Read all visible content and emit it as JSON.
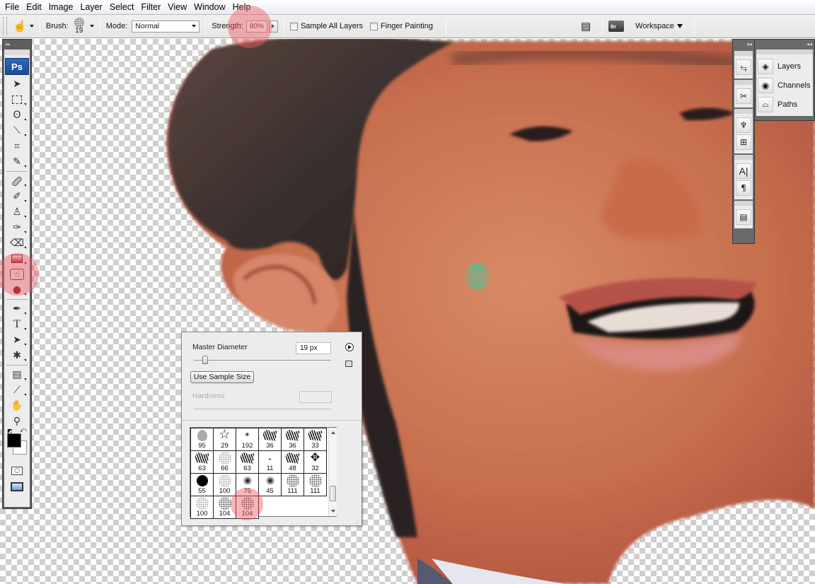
{
  "menu": [
    "File",
    "Edit",
    "Image",
    "Layer",
    "Select",
    "Filter",
    "View",
    "Window",
    "Help"
  ],
  "options_bar": {
    "tool_preset_icon": "smudge-tool-icon",
    "brush_label": "Brush:",
    "brush_size": "19",
    "mode_label": "Mode:",
    "mode_value": "Normal",
    "strength_label": "Strength:",
    "strength_value": "80%",
    "sample_all_layers_label": "Sample All Layers",
    "sample_all_layers_checked": false,
    "finger_painting_label": "Finger Painting",
    "finger_painting_checked": false,
    "workspace_label": "Workspace"
  },
  "toolbox": {
    "logo": "Ps",
    "tools": [
      {
        "name": "move-tool",
        "glyph": "➤"
      },
      {
        "name": "marquee-tool",
        "glyph": "⬚"
      },
      {
        "name": "lasso-tool",
        "glyph": "ʘ"
      },
      {
        "name": "quick-selection-tool",
        "glyph": "⟋"
      },
      {
        "name": "crop-tool",
        "glyph": "⌗"
      },
      {
        "name": "slice-tool",
        "glyph": "✎"
      },
      {
        "name": "healing-brush-tool",
        "glyph": "✚"
      },
      {
        "name": "brush-tool",
        "glyph": "🖌"
      },
      {
        "name": "clone-stamp-tool",
        "glyph": "♙"
      },
      {
        "name": "history-brush-tool",
        "glyph": "⟲"
      },
      {
        "name": "eraser-tool",
        "glyph": "◇"
      },
      {
        "name": "gradient-tool",
        "glyph": "▬"
      },
      {
        "name": "smudge-tool",
        "glyph": "☝"
      },
      {
        "name": "burn-tool",
        "glyph": "●"
      },
      {
        "name": "pen-tool",
        "glyph": "✒"
      },
      {
        "name": "type-tool",
        "glyph": "T"
      },
      {
        "name": "path-selection-tool",
        "glyph": "➤"
      },
      {
        "name": "custom-shape-tool",
        "glyph": "✱"
      },
      {
        "name": "notes-tool",
        "glyph": "▤"
      },
      {
        "name": "eyedropper-tool",
        "glyph": "⟋"
      },
      {
        "name": "hand-tool",
        "glyph": "✋"
      },
      {
        "name": "zoom-tool",
        "glyph": "🔍"
      }
    ],
    "active_tool": "smudge-tool",
    "foreground_color": "#000000",
    "background_color": "#ffffff"
  },
  "panels": {
    "layers_group": [
      "Layers",
      "Channels",
      "Paths"
    ]
  },
  "brush_picker": {
    "master_diameter_label": "Master Diameter",
    "master_diameter_value": "19 px",
    "use_sample_size_label": "Use Sample Size",
    "hardness_label": "Hardness:",
    "hardness_value": "",
    "presets": [
      {
        "size": "95",
        "kind": "leaf"
      },
      {
        "size": "29",
        "kind": "star"
      },
      {
        "size": "192",
        "kind": "starburst"
      },
      {
        "size": "36",
        "kind": "grass"
      },
      {
        "size": "36",
        "kind": "grass"
      },
      {
        "size": "33",
        "kind": "grass"
      },
      {
        "size": "63",
        "kind": "grass"
      },
      {
        "size": "66",
        "kind": "speckle-light"
      },
      {
        "size": "63",
        "kind": "grass"
      },
      {
        "size": "11",
        "kind": "dash"
      },
      {
        "size": "48",
        "kind": "grass"
      },
      {
        "size": "32",
        "kind": "maple"
      },
      {
        "size": "55",
        "kind": "hard-round"
      },
      {
        "size": "100",
        "kind": "speckle-light"
      },
      {
        "size": "75",
        "kind": "soft-round"
      },
      {
        "size": "45",
        "kind": "soft-round"
      },
      {
        "size": "111",
        "kind": "speckle"
      },
      {
        "size": "111",
        "kind": "speckle"
      },
      {
        "size": "100",
        "kind": "speckle-light"
      },
      {
        "size": "104",
        "kind": "speckle"
      },
      {
        "size": "104",
        "kind": "speckle"
      }
    ],
    "selected_index": 20
  },
  "colors": {
    "highlight": "#f05a64",
    "brush_cursor": "#3fc9a0"
  }
}
